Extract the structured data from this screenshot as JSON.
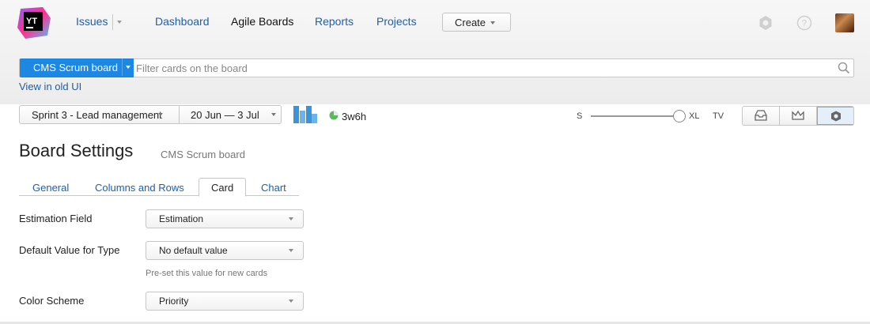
{
  "logo": {
    "text": "YT"
  },
  "nav": {
    "issues": "Issues",
    "dashboard": "Dashboard",
    "agile_boards": "Agile Boards",
    "reports": "Reports",
    "projects": "Projects",
    "create": "Create"
  },
  "search": {
    "board_name": "CMS Scrum board",
    "placeholder": "Filter cards on the board"
  },
  "old_ui_link": "View in old UI",
  "toolbar": {
    "sprint": "Sprint 3 - Lead management",
    "dates": "20 Jun — 3 Jul",
    "effort": "3w6h",
    "size_s": "S",
    "size_xl": "XL",
    "size_tv": "TV"
  },
  "page": {
    "title": "Board Settings",
    "subtitle": "CMS Scrum board"
  },
  "tabs": [
    "General",
    "Columns and Rows",
    "Card",
    "Chart"
  ],
  "active_tab": "Card",
  "form": {
    "estimation_label": "Estimation Field",
    "estimation_value": "Estimation",
    "default_type_label": "Default Value for Type",
    "default_type_value": "No default value",
    "default_type_hint": "Pre-set this value for new cards",
    "color_scheme_label": "Color Scheme",
    "color_scheme_value": "Priority"
  },
  "colors": {
    "accent": "#1d87e4",
    "link": "#1a5fb4",
    "effort_indicator": "#5cb85c"
  },
  "icons": [
    "settings-gear-icon",
    "help-icon",
    "search-icon",
    "chart-bars-icon",
    "inbox-icon",
    "crown-icon",
    "gear-icon"
  ]
}
